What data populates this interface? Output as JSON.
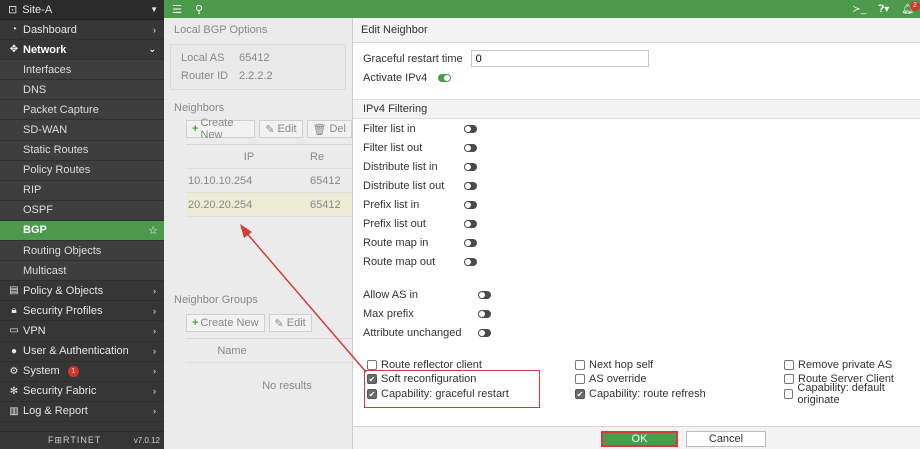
{
  "sidebar": {
    "device": "Site-A",
    "items": [
      {
        "label": "Dashboard",
        "icon": "dashboard-icon"
      },
      {
        "label": "Network",
        "icon": "network-icon"
      },
      {
        "label": "Interfaces"
      },
      {
        "label": "DNS"
      },
      {
        "label": "Packet Capture"
      },
      {
        "label": "SD-WAN"
      },
      {
        "label": "Static Routes"
      },
      {
        "label": "Policy Routes"
      },
      {
        "label": "RIP"
      },
      {
        "label": "OSPF"
      },
      {
        "label": "BGP"
      },
      {
        "label": "Routing Objects"
      },
      {
        "label": "Multicast"
      },
      {
        "label": "Policy & Objects",
        "icon": "policy-icon"
      },
      {
        "label": "Security Profiles",
        "icon": "lock-icon"
      },
      {
        "label": "VPN",
        "icon": "vpn-icon"
      },
      {
        "label": "User & Authentication",
        "icon": "user-icon"
      },
      {
        "label": "System",
        "icon": "gear-icon",
        "badge": "1"
      },
      {
        "label": "Security Fabric",
        "icon": "fabric-icon"
      },
      {
        "label": "Log & Report",
        "icon": "chart-icon"
      }
    ],
    "brand": "F⊞RTINET",
    "version": "v7.0.12"
  },
  "topbar": {
    "notif_count": "2"
  },
  "main": {
    "local_bgp_title": "Local BGP Options",
    "local_as_label": "Local AS",
    "local_as_value": "65412",
    "router_id_label": "Router ID",
    "router_id_value": "2.2.2.2",
    "neighbors_title": "Neighbors",
    "create_new": "Create New",
    "edit": "Edit",
    "delete": "Del",
    "col_ip": "IP",
    "col_re": "Re",
    "neighbors": [
      {
        "ip": "10.10.10.254",
        "as": "65412"
      },
      {
        "ip": "20.20.20.254",
        "as": "65412"
      }
    ],
    "groups_title": "Neighbor Groups",
    "col_name": "Name",
    "no_results": "No results"
  },
  "edit_neighbor": {
    "title": "Edit Neighbor",
    "graceful_label": "Graceful restart time",
    "graceful_value": "0",
    "activate_ipv4": "Activate IPv4",
    "ipv4_filtering": "IPv4 Filtering",
    "filters": [
      "Filter list in",
      "Filter list out",
      "Distribute list in",
      "Distribute list out",
      "Prefix list in",
      "Prefix list out",
      "Route map in",
      "Route map out"
    ],
    "extra": [
      "Allow AS in",
      "Max prefix",
      "Attribute unchanged"
    ],
    "checkboxes": [
      {
        "label": "Route reflector client",
        "checked": false
      },
      {
        "label": "Soft reconfiguration",
        "checked": true
      },
      {
        "label": "Capability: graceful restart",
        "checked": true
      },
      {
        "label": "Next hop self",
        "checked": false
      },
      {
        "label": "AS override",
        "checked": false
      },
      {
        "label": "Capability: route refresh",
        "checked": true
      },
      {
        "label": "Remove private AS",
        "checked": false
      },
      {
        "label": "Route Server Client",
        "checked": false
      },
      {
        "label": "Capability: default originate",
        "checked": false
      }
    ],
    "ok": "OK",
    "cancel": "Cancel"
  }
}
